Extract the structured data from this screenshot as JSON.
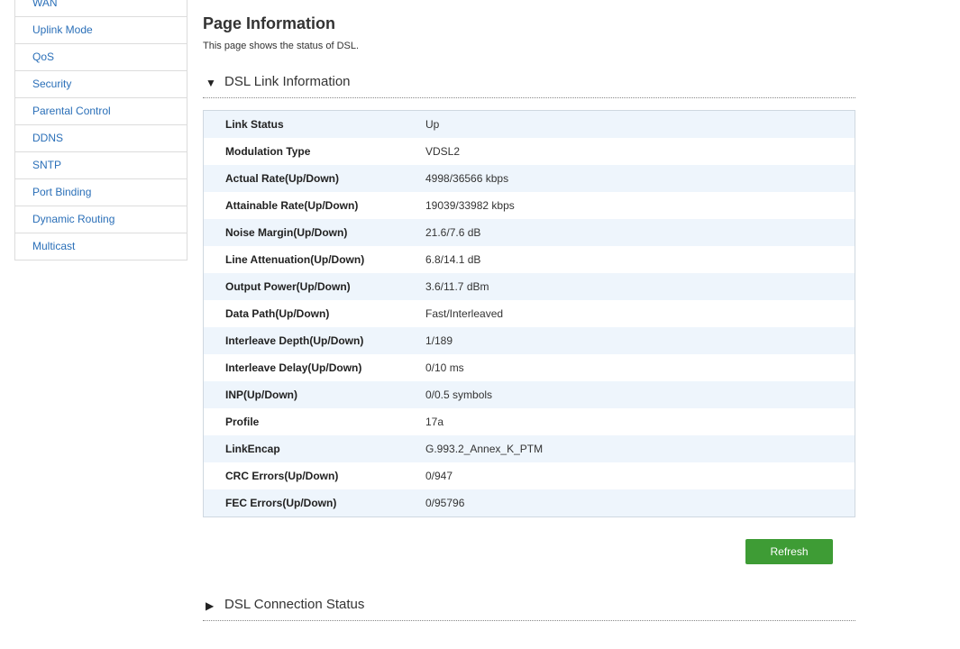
{
  "sidebar": {
    "items": [
      {
        "label": "WAN"
      },
      {
        "label": "Uplink Mode"
      },
      {
        "label": "QoS"
      },
      {
        "label": "Security"
      },
      {
        "label": "Parental Control"
      },
      {
        "label": "DDNS"
      },
      {
        "label": "SNTP"
      },
      {
        "label": "Port Binding"
      },
      {
        "label": "Dynamic Routing"
      },
      {
        "label": "Multicast"
      }
    ]
  },
  "page": {
    "title": "Page Information",
    "description": "This page shows the status of DSL."
  },
  "dsl_link": {
    "heading": "DSL Link Information",
    "expanded_icon": "triangle-down-icon",
    "rows": [
      {
        "label": "Link Status",
        "value": "Up"
      },
      {
        "label": "Modulation Type",
        "value": "VDSL2"
      },
      {
        "label": "Actual Rate(Up/Down)",
        "value": "4998/36566 kbps"
      },
      {
        "label": "Attainable Rate(Up/Down)",
        "value": "19039/33982 kbps"
      },
      {
        "label": "Noise Margin(Up/Down)",
        "value": "21.6/7.6 dB"
      },
      {
        "label": "Line Attenuation(Up/Down)",
        "value": "6.8/14.1 dB"
      },
      {
        "label": "Output Power(Up/Down)",
        "value": "3.6/11.7 dBm"
      },
      {
        "label": "Data Path(Up/Down)",
        "value": "Fast/Interleaved"
      },
      {
        "label": "Interleave Depth(Up/Down)",
        "value": "1/189"
      },
      {
        "label": "Interleave Delay(Up/Down)",
        "value": "0/10 ms"
      },
      {
        "label": "INP(Up/Down)",
        "value": "0/0.5 symbols"
      },
      {
        "label": "Profile",
        "value": "17a"
      },
      {
        "label": "LinkEncap",
        "value": "G.993.2_Annex_K_PTM"
      },
      {
        "label": "CRC Errors(Up/Down)",
        "value": "0/947"
      },
      {
        "label": "FEC Errors(Up/Down)",
        "value": "0/95796"
      }
    ]
  },
  "refresh_label": "Refresh",
  "dsl_connection": {
    "heading": "DSL Connection Status",
    "collapsed_icon": "triangle-right-icon"
  },
  "colors": {
    "link": "#2a6fb8",
    "button": "#3e9c35",
    "row_stripe": "#eef5fc"
  }
}
